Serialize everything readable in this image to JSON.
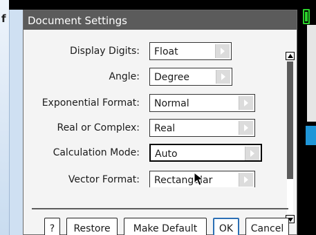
{
  "dialog": {
    "title": "Document Settings"
  },
  "settings": [
    {
      "label": "Display Digits:",
      "value": "Float"
    },
    {
      "label": "Angle:",
      "value": "Degree"
    },
    {
      "label": "Exponential Format:",
      "value": "Normal"
    },
    {
      "label": "Real or Complex:",
      "value": "Real"
    },
    {
      "label": "Calculation Mode:",
      "value": "Auto"
    },
    {
      "label": "Vector Format:",
      "value": "Rectangular"
    }
  ],
  "buttons": {
    "help": "?",
    "restore": "Restore",
    "make_default": "Make Default",
    "ok": "OK",
    "cancel": "Cancel"
  },
  "colors": {
    "titlebar": "#5b5b5b",
    "ok_focus": "#2c6fb4"
  },
  "scroll": {
    "position_fraction": 0.0
  }
}
